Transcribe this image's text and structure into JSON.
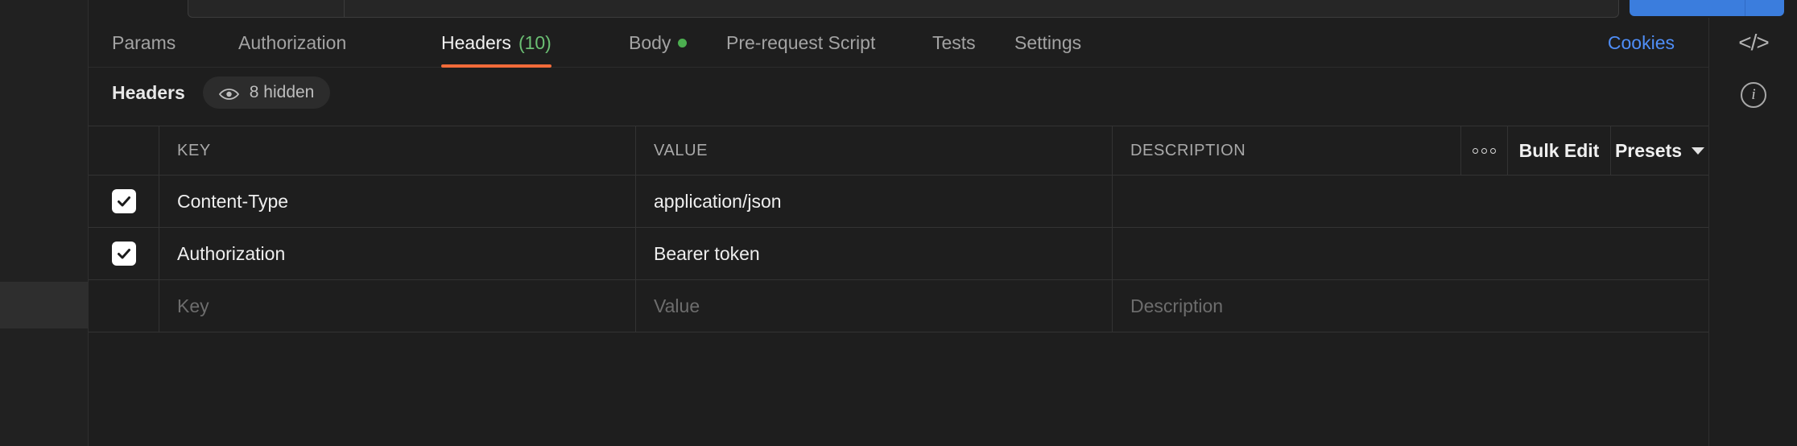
{
  "app": {
    "accent_orange": "#f26b3a",
    "accent_blue": "#3b7ddd",
    "link_blue": "#4f8ef7",
    "green": "#4caf50",
    "background": "#1e1e1e"
  },
  "tabs": [
    {
      "label": "Params",
      "active": false,
      "count": null,
      "dot": false
    },
    {
      "label": "Authorization",
      "active": false,
      "count": null,
      "dot": false
    },
    {
      "label": "Headers",
      "active": true,
      "count": "(10)",
      "dot": false
    },
    {
      "label": "Body",
      "active": false,
      "count": null,
      "dot": true
    },
    {
      "label": "Pre-request Script",
      "active": false,
      "count": null,
      "dot": false
    },
    {
      "label": "Tests",
      "active": false,
      "count": null,
      "dot": false
    },
    {
      "label": "Settings",
      "active": false,
      "count": null,
      "dot": false
    }
  ],
  "cookies_link": "Cookies",
  "right_rail": {
    "code_icon": "code-icon",
    "code_glyph": "</>",
    "info_icon": "info-icon",
    "info_glyph": "i"
  },
  "subheader": {
    "title": "Headers",
    "hidden_pill": "8 hidden",
    "eye_icon": "eye-icon"
  },
  "table": {
    "columns": {
      "key": "KEY",
      "value": "VALUE",
      "description": "DESCRIPTION"
    },
    "actions": {
      "more": "•••",
      "bulk_edit": "Bulk Edit",
      "presets": "Presets"
    },
    "rows": [
      {
        "checked": true,
        "key": "Content-Type",
        "value": "application/json",
        "description": ""
      },
      {
        "checked": true,
        "key": "Authorization",
        "value": "Bearer token",
        "description": ""
      }
    ],
    "placeholder_row": {
      "key": "Key",
      "value": "Value",
      "description": "Description"
    }
  }
}
